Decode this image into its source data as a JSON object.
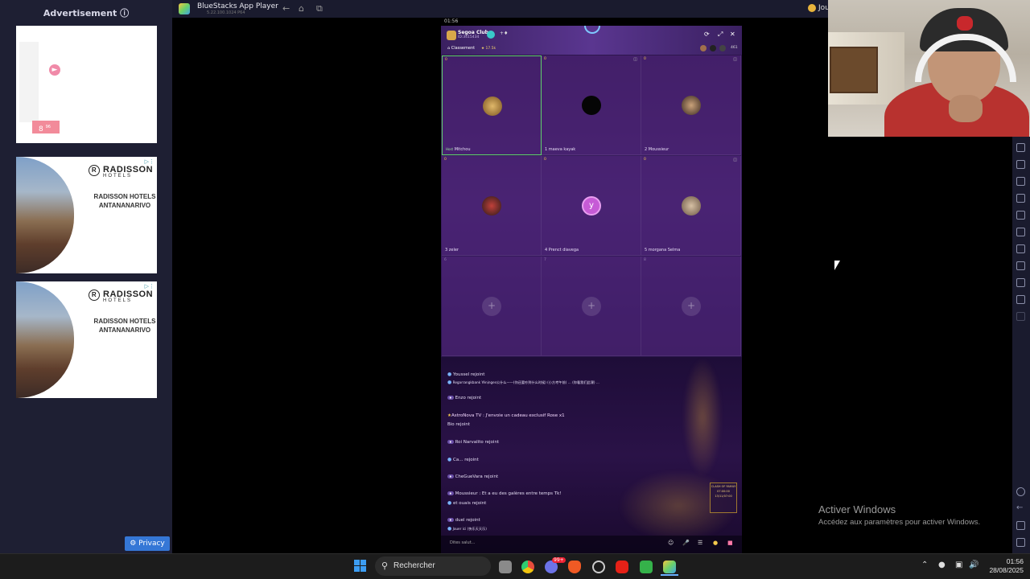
{
  "ads": {
    "title": "Advertisement ⓘ",
    "ad1_price": "8",
    "ad1_price_small": "96",
    "radisson_brand": "RADISSON",
    "radisson_sub": "HOTELS",
    "radisson_mark": "R",
    "radisson_copy": "RADISSON HOTELS ANTANANARIVO",
    "privacy_label": "Privacy"
  },
  "bluestacks": {
    "title": "BlueStacks App Player",
    "version": "5.22.100.1024  P64",
    "user_label": "Jou"
  },
  "phone": {
    "status_time": "01:56",
    "club_name": "Segoa Club",
    "club_id": "ID:3415434",
    "ranking_label": "Classement",
    "ranking_count": "★ 17.5k",
    "online_count": "461",
    "seats": [
      {
        "num": "0",
        "label": "Mitchou",
        "tag": "Host"
      },
      {
        "num": "0",
        "label": "1  maeva kayak"
      },
      {
        "num": "0",
        "label": "2  Moussieur"
      },
      {
        "num": "0",
        "label": "3  zeler"
      },
      {
        "num": "0",
        "label": "4  Prenct diavega",
        "letter": "y"
      },
      {
        "num": "0",
        "label": "5  morgana Selma"
      },
      {
        "num": "6",
        "label": ""
      },
      {
        "num": "7",
        "label": ""
      },
      {
        "num": "8",
        "label": ""
      }
    ],
    "chat": [
      "Youssel rejoint",
      "Regarrangkbank Yénịnges公什么——(你还要吵到什么时候)   (小方考午前) … (你看我们此课) ...",
      "Enzo rejoint",
      "AstroNova TV : J'envoie un cadeau exclusif Rose x1",
      "Bio rejoint",
      "Roi Narvalito rejoint",
      "Ca... rejoint",
      "CheGueVara rejoint",
      "Moussieur : Et a eu des galères entre temps Tk!",
      "et ouais rejoint",
      "duel rejoint",
      "Jouer ici (快乐天天乐)"
    ],
    "chat_placeholder": "Dites salut...",
    "clash_label": "CLASH OF FAMILY",
    "clash_time": "07:00:00",
    "clash_date": "13/11/07:00"
  },
  "windows": {
    "activate_title": "Activer Windows",
    "activate_sub": "Accédez aux paramètres pour activer Windows.",
    "search_label": "Rechercher",
    "time": "01:56",
    "date": "28/08/2025",
    "notif_badge": "99+"
  }
}
